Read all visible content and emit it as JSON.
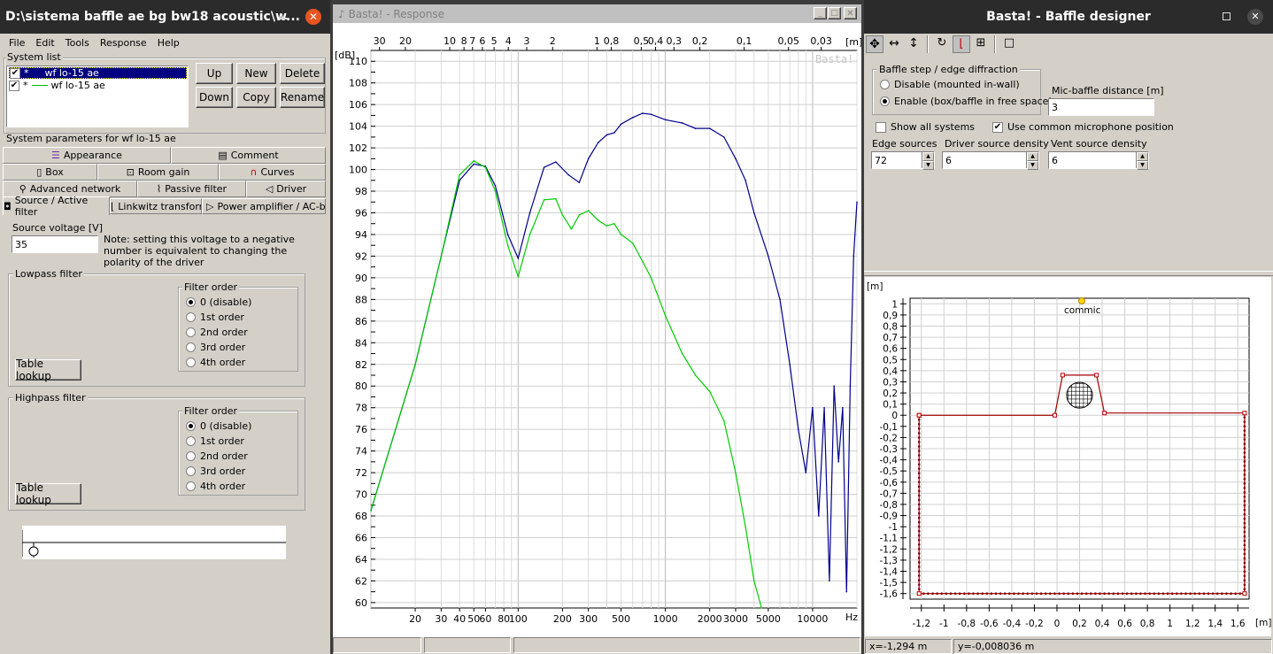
{
  "left_window": {
    "title": "D:\\sistema baffle ae bg bw18 acoustic\\w...",
    "menu": [
      "File",
      "Edit",
      "Tools",
      "Response",
      "Help"
    ],
    "system_list_label": "System list",
    "systems": [
      {
        "mark": "*",
        "name": "wf lo-15 ae",
        "checked": true,
        "selected": true
      },
      {
        "mark": "*",
        "name": "wf lo-15 ae",
        "checked": true,
        "selected": false,
        "color": "#00c000"
      }
    ],
    "buttons": {
      "up": "Up",
      "new": "New",
      "delete": "Delete",
      "down": "Down",
      "copy": "Copy",
      "rename": "Rename"
    },
    "params_label": "System parameters for wf lo-15 ae",
    "tabs_row1": [
      "Appearance",
      "Comment"
    ],
    "tabs_row2": [
      "Box",
      "Room gain",
      "Curves"
    ],
    "tabs_row3": [
      "Advanced network",
      "Passive filter",
      "Driver"
    ],
    "tabs_row4": [
      "Source / Active filter",
      "Linkwitz transform",
      "Power amplifier / AC-bas"
    ],
    "source_voltage_label": "Source voltage [V]",
    "source_voltage_value": "35",
    "note": "Note: setting this voltage to a negative number is equivalent to changing the polarity of the driver",
    "lowpass_label": "Lowpass filter",
    "highpass_label": "Highpass filter",
    "filter_order_label": "Filter order",
    "filter_orders": [
      "0 (disable)",
      "1st order",
      "2nd order",
      "3rd order",
      "4th order"
    ],
    "table_lookup": "Table lookup"
  },
  "response_window": {
    "title": "Basta! - Response",
    "watermark": "Basta!",
    "db_label": "[dB]",
    "m_label": "[m]",
    "hz_label": "Hz",
    "wavelength_ticks": [
      "30",
      "20",
      "10",
      "8",
      "7",
      "6",
      "5",
      "4",
      "3",
      "2",
      "1",
      "0,8",
      "0,5",
      "0,4",
      "0,3",
      "0,2",
      "0,1",
      "0,05",
      "0,03"
    ],
    "freq_ticks": [
      "20",
      "30",
      "40",
      "50",
      "60",
      "80",
      "100",
      "200",
      "300",
      "500",
      "1000",
      "2000",
      "3000",
      "5000",
      "10000"
    ],
    "db_ticks": [
      "110",
      "108",
      "106",
      "104",
      "102",
      "100",
      "98",
      "96",
      "94",
      "92",
      "90",
      "88",
      "86",
      "84",
      "82",
      "80",
      "78",
      "76",
      "74",
      "72",
      "70",
      "68",
      "66",
      "64",
      "62",
      "60"
    ]
  },
  "chart_data": {
    "type": "line",
    "xscale": "log",
    "xlim": [
      10,
      20000
    ],
    "ylim": [
      59.5,
      111
    ],
    "xlabel": "Hz",
    "ylabel": "[dB]",
    "grid": true,
    "series": [
      {
        "color": "#00008b",
        "points": [
          [
            10,
            68.5
          ],
          [
            20,
            82
          ],
          [
            30,
            92
          ],
          [
            40,
            99
          ],
          [
            50,
            100.5
          ],
          [
            60,
            100.3
          ],
          [
            70,
            98.5
          ],
          [
            85,
            94
          ],
          [
            100,
            91.8
          ],
          [
            120,
            96
          ],
          [
            150,
            100.2
          ],
          [
            180,
            100.7
          ],
          [
            220,
            99.5
          ],
          [
            260,
            98.8
          ],
          [
            300,
            101
          ],
          [
            350,
            102.5
          ],
          [
            400,
            103.2
          ],
          [
            450,
            103.4
          ],
          [
            500,
            104.2
          ],
          [
            600,
            104.8
          ],
          [
            700,
            105.2
          ],
          [
            800,
            105.1
          ],
          [
            1000,
            104.6
          ],
          [
            1300,
            104.3
          ],
          [
            1600,
            103.8
          ],
          [
            2000,
            103.8
          ],
          [
            2500,
            103
          ],
          [
            3000,
            101
          ],
          [
            3500,
            99
          ],
          [
            4000,
            96
          ],
          [
            5000,
            92
          ],
          [
            6000,
            88
          ],
          [
            7000,
            82
          ],
          [
            8000,
            76
          ],
          [
            9000,
            72
          ],
          [
            10000,
            78
          ],
          [
            11000,
            68
          ],
          [
            12000,
            78
          ],
          [
            13000,
            62
          ],
          [
            14000,
            80
          ],
          [
            15000,
            73
          ],
          [
            16000,
            78
          ],
          [
            17000,
            61
          ],
          [
            18000,
            80
          ],
          [
            19000,
            92
          ],
          [
            20000,
            97
          ]
        ]
      },
      {
        "color": "#00cc00",
        "points": [
          [
            10,
            68.5
          ],
          [
            20,
            82
          ],
          [
            30,
            92
          ],
          [
            40,
            99.5
          ],
          [
            50,
            100.8
          ],
          [
            60,
            100.2
          ],
          [
            70,
            98
          ],
          [
            85,
            93
          ],
          [
            100,
            90.1
          ],
          [
            120,
            94
          ],
          [
            150,
            97.2
          ],
          [
            180,
            97.3
          ],
          [
            200,
            95.8
          ],
          [
            230,
            94.5
          ],
          [
            260,
            95.8
          ],
          [
            300,
            96.2
          ],
          [
            350,
            95.3
          ],
          [
            400,
            94.8
          ],
          [
            450,
            95
          ],
          [
            500,
            94
          ],
          [
            600,
            93.2
          ],
          [
            700,
            91.5
          ],
          [
            800,
            90
          ],
          [
            1000,
            86.5
          ],
          [
            1300,
            83
          ],
          [
            1600,
            81
          ],
          [
            2000,
            79.5
          ],
          [
            2500,
            76.8
          ],
          [
            3000,
            72
          ],
          [
            3500,
            67
          ],
          [
            4000,
            62
          ],
          [
            4500,
            59.5
          ]
        ]
      }
    ]
  },
  "baffle_window": {
    "title": "Basta! - Baffle designer",
    "group_label": "Baffle step / edge diffraction",
    "disable_label": "Disable (mounted in-wall)",
    "enable_label": "Enable (box/baffle in free space)",
    "mic_distance_label": "Mic-baffle distance [m]",
    "mic_distance_value": "3",
    "show_all_label": "Show all systems",
    "use_common_label": "Use common microphone position",
    "edge_sources_label": "Edge sources",
    "edge_sources_value": "72",
    "driver_density_label": "Driver source density",
    "driver_density_value": "6",
    "vent_density_label": "Vent source density",
    "vent_density_value": "6",
    "plot_unit": "[m]",
    "mic_label": "commic",
    "y_ticks": [
      "1",
      "0,9",
      "0,8",
      "0,7",
      "0,6",
      "0,5",
      "0,4",
      "0,3",
      "0,2",
      "0,1",
      "0",
      "-0,1",
      "-0,2",
      "-0,3",
      "-0,4",
      "-0,5",
      "-0,6",
      "-0,7",
      "-0,8",
      "-0,9",
      "-1",
      "-1,1",
      "-1,2",
      "-1,3",
      "-1,4",
      "-1,5",
      "-1,6"
    ],
    "x_ticks": [
      "-1,2",
      "-1",
      "-0,8",
      "-0,6",
      "-0,4",
      "-0,2",
      "0",
      "0,2",
      "0,4",
      "0,6",
      "0,8",
      "1",
      "1,2",
      "1,4",
      "1,6"
    ],
    "status_x": "x=-1,294 m",
    "status_y": "y=-0,008036 m"
  }
}
